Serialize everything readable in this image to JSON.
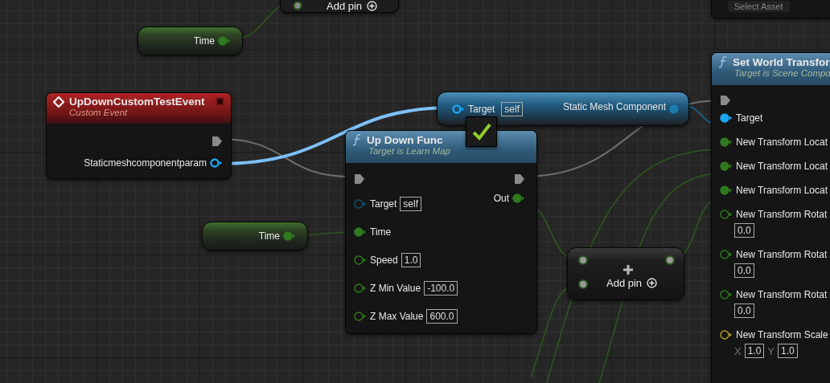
{
  "asset_picker": {
    "label": "Select Asset"
  },
  "top_add_node": {
    "label": "Add pin"
  },
  "time_getter_top": {
    "label": "Time",
    "pin": {
      "kind": "float",
      "connected": true
    }
  },
  "event_node": {
    "title": "UpDownCustomTestEvent",
    "subtitle": "Custom Event",
    "output": {
      "label": "Staticmeshcomponentparam",
      "kind": "object",
      "connected": true
    }
  },
  "component_getter": {
    "input": {
      "label": "Target",
      "value": "self",
      "kind": "object",
      "connected": true
    },
    "output": {
      "label": "Static Mesh Component",
      "kind": "object",
      "connected": true
    }
  },
  "compile_status": {
    "ok": true
  },
  "function_node": {
    "title": "Up Down Func",
    "subtitle": "Target is Learn Map",
    "output": {
      "label": "Out",
      "kind": "float",
      "connected": true
    },
    "inputs": [
      {
        "label": "Target",
        "value": "self",
        "kind": "object",
        "connected": false
      },
      {
        "label": "Time",
        "kind": "float",
        "connected": true
      },
      {
        "label": "Speed",
        "value": "1.0",
        "kind": "float",
        "connected": false
      },
      {
        "label": "Z Min Value",
        "value": "-100.0",
        "kind": "float",
        "connected": false
      },
      {
        "label": "Z Max Value",
        "value": "600.0",
        "kind": "float",
        "connected": false
      }
    ]
  },
  "time_getter": {
    "label": "Time",
    "pin": {
      "kind": "float",
      "connected": true
    }
  },
  "add_node": {
    "label": "Add pin"
  },
  "set_node": {
    "title": "Set World Transfor",
    "subtitle": "Target is Scene Compo",
    "inputs": [
      {
        "label": "Target",
        "kind": "object",
        "connected": true
      },
      {
        "label": "New Transform Locat",
        "kind": "float",
        "connected": true
      },
      {
        "label": "New Transform Locat",
        "kind": "float",
        "connected": true
      },
      {
        "label": "New Transform Locat",
        "kind": "float",
        "connected": true
      },
      {
        "label": "New Transform Rotat",
        "value": "0.0",
        "kind": "float",
        "connected": false
      },
      {
        "label": "New Transform Rotat",
        "value": "0.0",
        "kind": "float",
        "connected": false
      },
      {
        "label": "New Transform Rotat",
        "value": "0.0",
        "kind": "float",
        "connected": false
      },
      {
        "label": "New Transform Scale",
        "kind": "vector",
        "connected": false,
        "values": [
          {
            "axis": "X",
            "value": "1.0"
          },
          {
            "axis": "Y",
            "value": "1.0"
          }
        ]
      }
    ]
  }
}
